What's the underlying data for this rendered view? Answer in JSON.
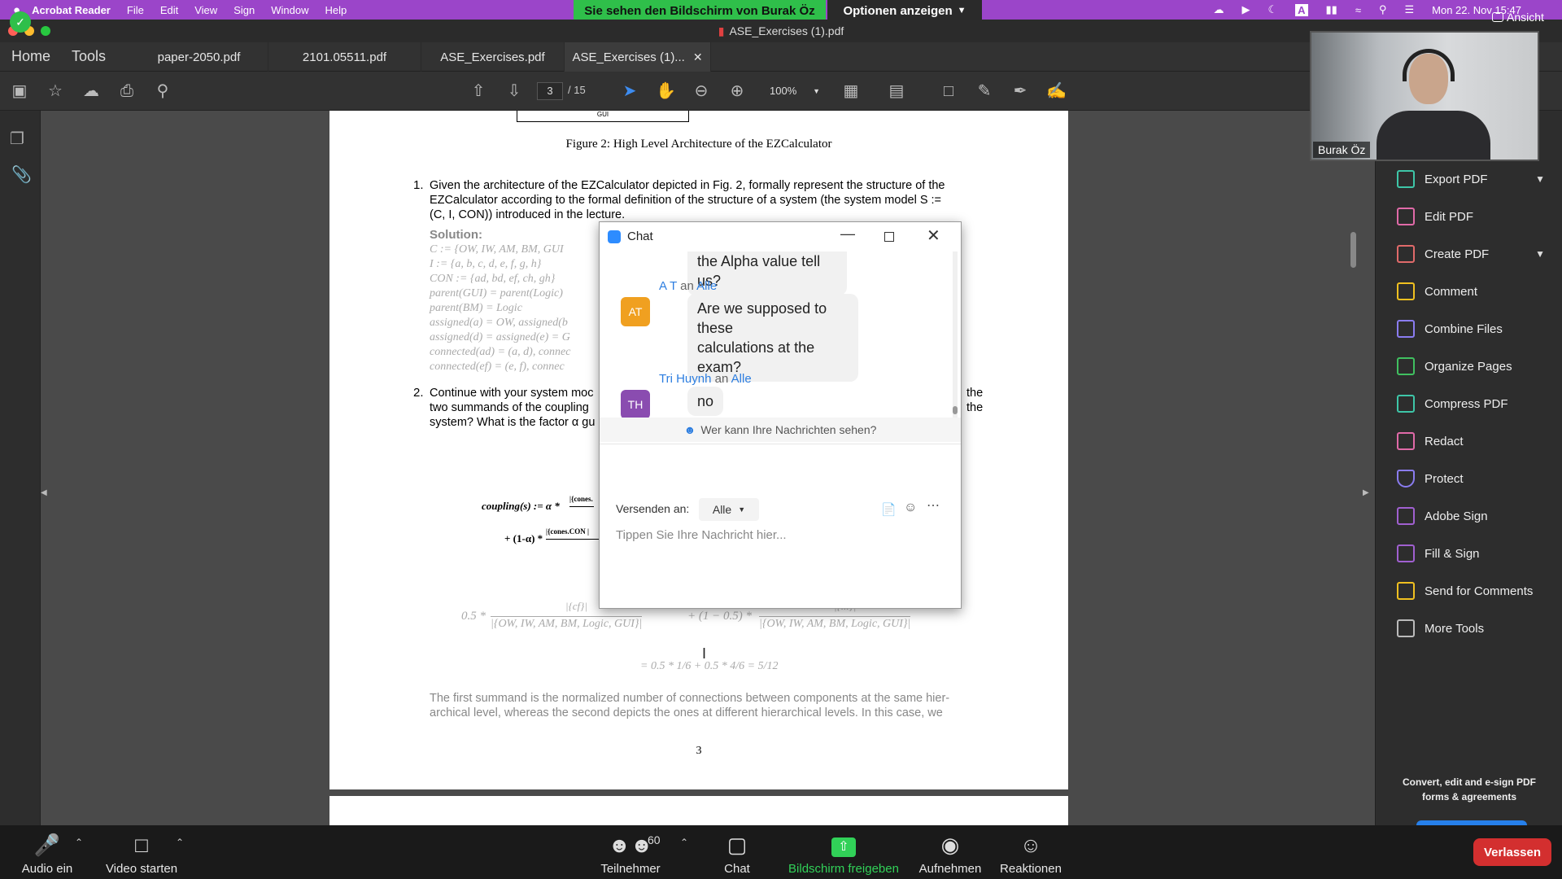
{
  "menubar": {
    "app": "Acrobat Reader",
    "menus": [
      "File",
      "Edit",
      "View",
      "Sign",
      "Window",
      "Help"
    ],
    "datetime": "Mon 22. Nov 15:47"
  },
  "zoom_share": {
    "banner": "Sie sehen den Bildschirm von Burak Öz",
    "options": "Optionen anzeigen",
    "view": "Ansicht"
  },
  "acrobat": {
    "window_title": "ASE_Exercises (1).pdf",
    "nav": {
      "home": "Home",
      "tools": "Tools"
    },
    "tabs": [
      "paper-2050.pdf",
      "2101.05511.pdf",
      "ASE_Exercises.pdf",
      "ASE_Exercises (1)..."
    ],
    "toolbar": {
      "page_current": "3",
      "page_total": "/ 15",
      "zoom": "100%"
    }
  },
  "pdf": {
    "fig_box_label": "GUI",
    "figure_caption": "Figure 2: High Level Architecture of the EZCalculator",
    "q1_number": "1.",
    "q1_line1": "Given the architecture of the EZCalculator depicted in Fig. 2, formally represent the structure of the",
    "q1_line2": "EZCalculator according to the formal definition of the structure of a system (the system model S :=",
    "q1_line3": "(C, I, CON)) introduced in the lecture.",
    "solution_label": "Solution:",
    "solution_lines": [
      "C := {OW, IW, AM, BM, GUI",
      "I := {a, b, c, d, e, f, g, h}",
      "CON := {ad, bd, ef, ch, gh}",
      "parent(GUI) = parent(Logic)",
      "parent(BM) = Logic",
      "assigned(a) = OW, assigned(b",
      "assigned(d) = assigned(e) = G",
      "connected(ad) = (a, d), connec",
      "connected(ef) = (e, f), connec"
    ],
    "q2_number": "2.",
    "q2_line1": "Continue with your system moc",
    "q2_line2": "two summands of the coupling",
    "q2_line3": "system? What is the factor α gu",
    "q2_right1": "the",
    "q2_right2": "the",
    "formula_coupling": "coupling(s) := α *",
    "formula_frac1": "|{cones.",
    "formula_second": "+ (1-α) *",
    "formula_frac2": "|{cones.CON |",
    "calc_prefix": "0.5 *",
    "calc_num1": "|{cf}|",
    "calc_den1": "|{OW, IW, AM, BM, Logic, GUI}|",
    "calc_mid": "+ (1 − 0.5) *",
    "calc_num2": "|{...}|",
    "calc_den2": "|{OW, IW, AM, BM, Logic, GUI}|",
    "calc_result": "= 0.5 * 1/6 + 0.5 * 4/6 = 5/12",
    "para_line1": "The first summand is the normalized number of connections between components at the same hier-",
    "para_line2": "archical level, whereas the second depicts the ones at different hierarchical levels. In this case, we",
    "page_number": "3"
  },
  "right_panel": {
    "tools": [
      "Export PDF",
      "Edit PDF",
      "Create PDF",
      "Comment",
      "Combine Files",
      "Organize Pages",
      "Compress PDF",
      "Redact",
      "Protect",
      "Adobe Sign",
      "Fill & Sign",
      "Send for Comments",
      "More Tools"
    ],
    "promo_line1": "Convert, edit and e-sign PDF",
    "promo_line2": "forms & agreements",
    "tool_colors": [
      "#3ec6a8",
      "#e06aa8",
      "#e06a6a",
      "#f0c020",
      "#8a7cf0",
      "#40c060",
      "#3ec6a8",
      "#e06aa8",
      "#8a7cf0",
      "#a060d0",
      "#a060d0",
      "#f0c020",
      "#bbbbbb"
    ]
  },
  "webcam": {
    "name": "Burak Öz"
  },
  "chat": {
    "title": "Chat",
    "msg0_tail": "the Alpha value tell us?",
    "msg1": {
      "sender": "A T",
      "to_word": "an",
      "to": "Alle",
      "initials": "AT",
      "line1": "Are we supposed to these",
      "line2": "calculations at the exam?"
    },
    "msg2": {
      "sender": "Tri Huynh",
      "to_word": "an",
      "to": "Alle",
      "initials": "TH",
      "text": "no"
    },
    "visibility": "Wer kann Ihre Nachrichten sehen?",
    "send_to_label": "Versenden an:",
    "send_to_value": "Alle",
    "input_placeholder": "Tippen Sie Ihre Nachricht hier..."
  },
  "zoom_bar": {
    "audio": "Audio ein",
    "video": "Video starten",
    "participants": "Teilnehmer",
    "participants_count": "60",
    "chat": "Chat",
    "share": "Bildschirm freigeben",
    "record": "Aufnehmen",
    "reactions": "Reaktionen",
    "leave": "Verlassen"
  }
}
